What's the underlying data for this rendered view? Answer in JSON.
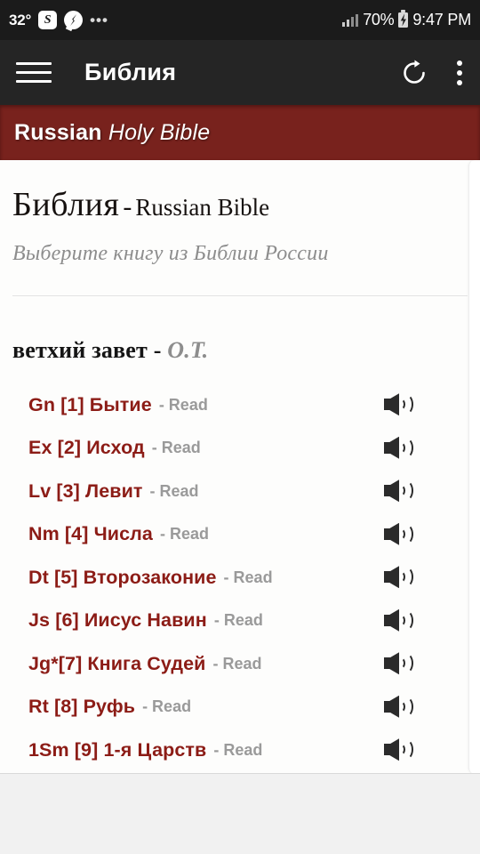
{
  "statusbar": {
    "temperature": "32°",
    "app_badge_letter": "S",
    "overflow_dots": "•••",
    "battery_percent": "70%",
    "time": "9:47 PM",
    "icons": [
      "skype-icon",
      "messenger-icon",
      "more-notifications-icon",
      "signal-icon",
      "battery-charging-icon"
    ]
  },
  "appbar": {
    "title": "Библия",
    "menu_icon": "hamburger-menu-icon",
    "refresh_icon": "refresh-icon",
    "overflow_icon": "kebab-menu-icon",
    "background": "#252525"
  },
  "banner": {
    "bold_text": "Russian",
    "italic_text": "Holy Bible",
    "background": "#78221d"
  },
  "page": {
    "title_main": "Библия",
    "title_dash": "-",
    "title_sub": "Russian Bible",
    "subtitle": "Выберите книгу из Библии России",
    "section_title": "ветхий завет - ",
    "section_abbrev": "O.T.",
    "read_label": "- Read",
    "link_color": "#8c1c16",
    "books": [
      {
        "name": "Gn [1] Бытие",
        "read": "- Read",
        "audio": "speaker-icon"
      },
      {
        "name": "Ex [2] Исход",
        "read": "- Read",
        "audio": "speaker-icon"
      },
      {
        "name": "Lv [3] Левит",
        "read": "- Read",
        "audio": "speaker-icon"
      },
      {
        "name": "Nm [4] Числа",
        "read": "- Read",
        "audio": "speaker-icon"
      },
      {
        "name": "Dt [5] Второзаконие",
        "read": "- Read",
        "audio": "speaker-icon"
      },
      {
        "name": "Js [6] Иисус Навин",
        "read": "- Read",
        "audio": "speaker-icon"
      },
      {
        "name": "Jg*[7] Книга Судей",
        "read": "- Read",
        "audio": "speaker-icon"
      },
      {
        "name": "Rt [8] Руфь",
        "read": "- Read",
        "audio": "speaker-icon"
      },
      {
        "name": "1Sm [9] 1-я Царств",
        "read": "- Read",
        "audio": "speaker-icon"
      }
    ]
  }
}
